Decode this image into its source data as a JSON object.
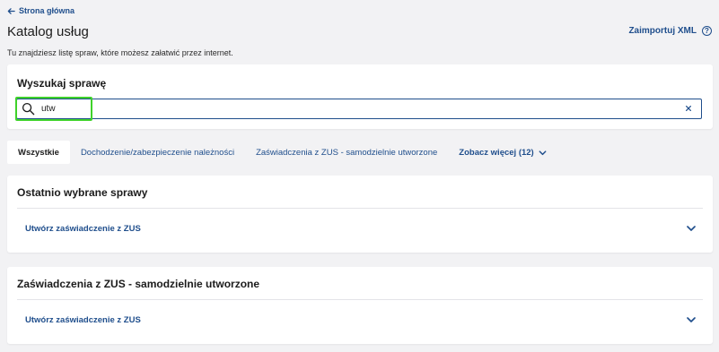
{
  "header": {
    "back_label": "Strona główna",
    "title": "Katalog usług",
    "import_label": "Zaimportuj XML",
    "help_symbol": "?",
    "subtitle": "Tu znajdziesz listę spraw, które możesz załatwić przez internet."
  },
  "search": {
    "title": "Wyszukaj sprawę",
    "value": "utw",
    "clear_symbol": "×"
  },
  "tabs": [
    {
      "label": "Wszystkie",
      "active": true
    },
    {
      "label": "Dochodzenie/zabezpieczenie należności"
    },
    {
      "label": "Zaświadczenia z ZUS - samodzielnie utworzone"
    },
    {
      "label": "Zobacz więcej (12)"
    }
  ],
  "sections": [
    {
      "title": "Ostatnio wybrane sprawy",
      "items": [
        {
          "label": "Utwórz zaświadczenie z ZUS"
        }
      ]
    },
    {
      "title": "Zaświadczenia z ZUS - samodzielnie utworzone",
      "items": [
        {
          "label": "Utwórz zaświadczenie z ZUS"
        }
      ]
    }
  ],
  "colors": {
    "accent": "#1f4e8c",
    "highlight": "#3fd22a",
    "background": "#f2f2f4"
  },
  "icons": {
    "back": "arrow-left-icon",
    "help": "help-circle-icon",
    "search": "search-icon",
    "clear": "close-icon",
    "more": "chevron-down-icon",
    "expand": "chevron-down-icon"
  }
}
